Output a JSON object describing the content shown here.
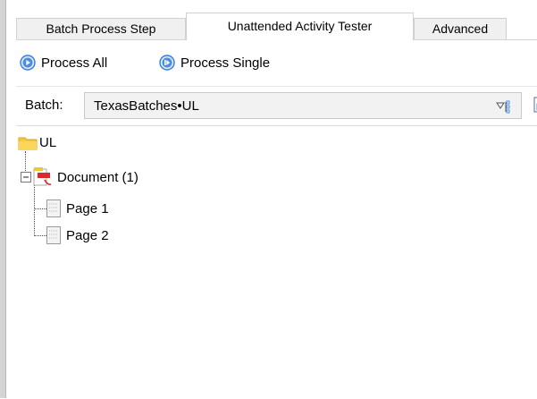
{
  "tabs": [
    {
      "label": "Batch Process Step"
    },
    {
      "label": "Unattended Activity Tester"
    },
    {
      "label": "Advanced"
    }
  ],
  "toolbar": {
    "process_all_label": "Process All",
    "process_single_label": "Process Single"
  },
  "batch": {
    "label": "Batch:",
    "value": "TexasBatches•UL"
  },
  "tree": {
    "root_label": "UL",
    "document_label": "Document (1)",
    "pages": [
      "Page 1",
      "Page 2"
    ]
  },
  "colors": {
    "folder": "#f5c842",
    "process_icon": "#3a7bd5",
    "pdf_red": "#d92b2b"
  }
}
